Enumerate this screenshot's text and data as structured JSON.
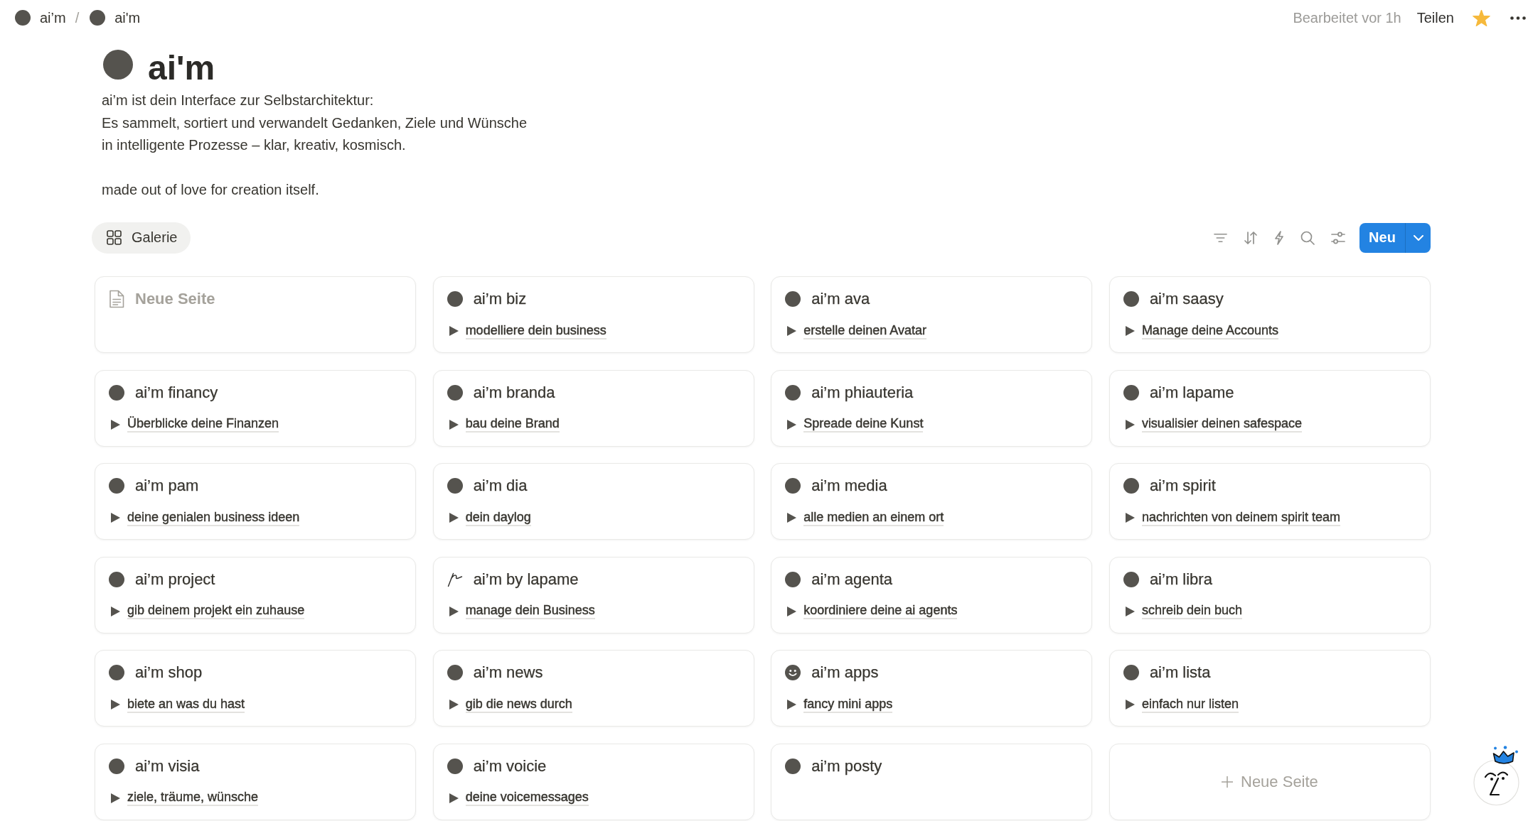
{
  "topbar": {
    "breadcrumb": {
      "separator": "/",
      "items": [
        {
          "text": "ai’m"
        },
        {
          "text": "ai'm"
        }
      ]
    },
    "edited": "Bearbeitet vor 1h",
    "share": "Teilen",
    "favorite": true
  },
  "page": {
    "title": "ai'm",
    "description": [
      "ai’m ist dein Interface zur Selbstarchitektur:\nEs sammelt, sortiert und verwandelt Gedanken, Ziele und Wünsche\nin intelligente Prozesse – klar, kreativ, kosmisch.",
      "made out of love for creation itself."
    ]
  },
  "view_tabs": [
    {
      "label": "Galerie",
      "selected": true
    }
  ],
  "toolbar": {
    "new_button": "Neu"
  },
  "cards": [
    {
      "kind": "untitled",
      "title": "Neue Seite"
    },
    {
      "kind": "dot",
      "title": "ai’m biz",
      "toggle": {
        "text": "modelliere dein business",
        "expanded": false
      }
    },
    {
      "kind": "dot",
      "title": "ai’m ava",
      "toggle": {
        "text": "erstelle deinen Avatar",
        "expanded": false
      }
    },
    {
      "kind": "dot",
      "title": "ai’m saasy",
      "toggle": {
        "text": "Manage deine Accounts",
        "expanded": false
      }
    },
    {
      "kind": "dot",
      "title": "ai’m financy",
      "toggle": {
        "text": "Überblicke deine Finanzen",
        "expanded": false
      }
    },
    {
      "kind": "dot",
      "title": "ai’m branda",
      "toggle": {
        "text": "bau deine Brand",
        "expanded": false
      }
    },
    {
      "kind": "dot",
      "title": "ai’m phiauteria",
      "toggle": {
        "text": "Spreade deine Kunst",
        "expanded": false
      }
    },
    {
      "kind": "dot",
      "title": "ai’m lapame",
      "toggle": {
        "text": "visualisier deinen safespace",
        "expanded": false
      }
    },
    {
      "kind": "dot",
      "title": "ai’m pam",
      "toggle": {
        "text": "deine genialen business ideen",
        "expanded": false
      }
    },
    {
      "kind": "dot",
      "title": "ai’m dia",
      "toggle": {
        "text": "dein daylog",
        "expanded": false
      }
    },
    {
      "kind": "dot",
      "title": "ai’m media",
      "toggle": {
        "text": "alle medien an einem ort",
        "expanded": false
      }
    },
    {
      "kind": "dot",
      "title": "ai’m spirit",
      "toggle": {
        "text": "nachrichten von deinem spirit team",
        "expanded": false
      }
    },
    {
      "kind": "dot",
      "title": "ai’m project",
      "toggle": {
        "text": "gib deinem projekt ein zuhause",
        "expanded": false
      }
    },
    {
      "kind": "scribble",
      "title": "ai’m by lapame",
      "toggle": {
        "text": "manage dein Business",
        "expanded": false
      }
    },
    {
      "kind": "dot",
      "title": "ai’m agenta",
      "toggle": {
        "text": "koordiniere deine ai agents",
        "expanded": false
      }
    },
    {
      "kind": "dot",
      "title": "ai’m libra",
      "toggle": {
        "text": "schreib dein buch",
        "expanded": false
      }
    },
    {
      "kind": "dot",
      "title": "ai’m shop",
      "toggle": {
        "text": "biete an was du hast",
        "expanded": false
      }
    },
    {
      "kind": "dot",
      "title": "ai’m news",
      "toggle": {
        "text": "gib die news durch",
        "expanded": false
      }
    },
    {
      "kind": "smiley",
      "title": "ai’m apps",
      "toggle": {
        "text": "fancy mini apps",
        "expanded": false
      }
    },
    {
      "kind": "dot",
      "title": "ai’m lista",
      "toggle": {
        "text": "einfach nur listen",
        "expanded": false
      }
    },
    {
      "kind": "dot",
      "title": "ai’m visia",
      "toggle": {
        "text": "ziele, träume, wünsche",
        "expanded": false
      }
    },
    {
      "kind": "dot",
      "title": "ai’m voicie",
      "toggle": {
        "text": "deine voicemessages",
        "expanded": false
      }
    },
    {
      "kind": "dot",
      "title": "ai’m posty"
    },
    {
      "kind": "add",
      "label": "Neue Seite"
    }
  ]
}
